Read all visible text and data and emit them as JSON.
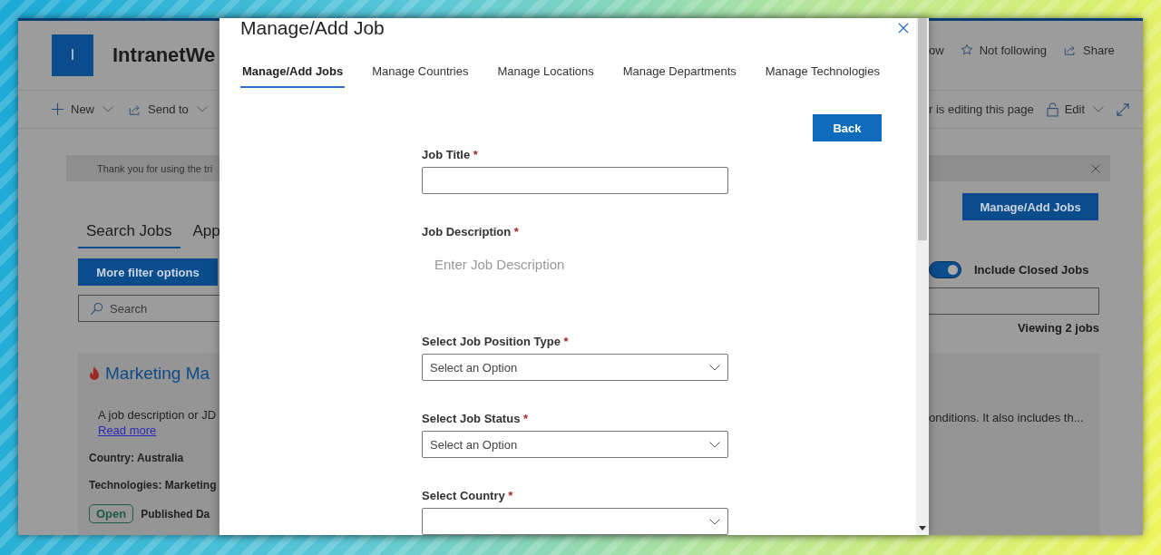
{
  "background_page": {
    "logo": "I",
    "site_title": "IntranetWe",
    "header_actions": [
      {
        "kind": "text",
        "label": "ow"
      },
      {
        "kind": "star",
        "label": "Not following"
      },
      {
        "kind": "share",
        "label": "Share"
      }
    ],
    "command_bar_left": [
      {
        "kind": "plus",
        "label": "New"
      },
      {
        "kind": "send",
        "label": "Send to"
      }
    ],
    "command_bar_right": [
      {
        "kind": "text",
        "label": "r is editing this page"
      },
      {
        "kind": "lock",
        "label": "Edit"
      },
      {
        "kind": "expand"
      }
    ],
    "notice": {
      "text": "Thank you for using the tri"
    },
    "tabs": [
      {
        "label": "Search Jobs",
        "selected": true
      },
      {
        "label": "App",
        "selected": false
      }
    ],
    "filter_button": "More filter options",
    "manage_button": "Manage/Add Jobs",
    "include_closed": {
      "label": "Include Closed Jobs",
      "on": true
    },
    "search": {
      "placeholder": "Search"
    },
    "result_count": "Viewing 2 jobs",
    "job_card": {
      "title": "Marketing Ma",
      "description_start": "A job description or JD",
      "description_end": "onditions. It also includes th...",
      "read_more": "Read more",
      "country": "Country: Australia",
      "technologies": "Technologies: Marketing",
      "status": "Open",
      "published": "Published Da"
    }
  },
  "modal": {
    "title": "Manage/Add Job",
    "tabs": [
      {
        "label": "Manage/Add Jobs",
        "selected": true
      },
      {
        "label": "Manage Countries",
        "selected": false
      },
      {
        "label": "Manage Locations",
        "selected": false
      },
      {
        "label": "Manage Departments",
        "selected": false
      },
      {
        "label": "Manage Technologies",
        "selected": false
      }
    ],
    "back_button": "Back",
    "fields": [
      {
        "kind": "text",
        "label": "Job Title",
        "required_mark": "*"
      },
      {
        "kind": "textarea",
        "label": "Job Description",
        "required_mark": "*",
        "placeholder": "Enter Job Description"
      },
      {
        "kind": "select",
        "label": "Select Job Position Type",
        "required_mark": "*",
        "placeholder": "Select an Option"
      },
      {
        "kind": "select",
        "label": "Select Job Status",
        "required_mark": "*",
        "placeholder": "Select an Option"
      },
      {
        "kind": "select",
        "label": "Select Country",
        "required_mark": "*"
      }
    ]
  }
}
